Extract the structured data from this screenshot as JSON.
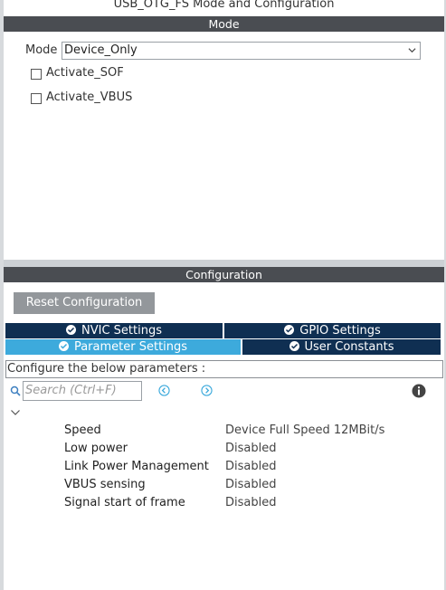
{
  "window_title": "USB_OTG_FS Mode and Configuration",
  "mode_section": {
    "header": "Mode",
    "mode_label": "Mode",
    "mode_value": "Device_Only",
    "checkboxes": [
      {
        "label": "Activate_SOF",
        "checked": false
      },
      {
        "label": "Activate_VBUS",
        "checked": false
      }
    ]
  },
  "config_section": {
    "header": "Configuration",
    "reset_button": "Reset Configuration",
    "tabs": [
      {
        "label": "NVIC Settings",
        "active": false
      },
      {
        "label": "GPIO Settings",
        "active": false
      },
      {
        "label": "Parameter Settings",
        "active": true
      },
      {
        "label": "User Constants",
        "active": false
      }
    ],
    "params_caption": "Configure the below parameters :",
    "search_placeholder": "Search (Ctrl+F)",
    "parameters": [
      {
        "name": "Speed",
        "value": "Device Full Speed 12MBit/s"
      },
      {
        "name": "Low power",
        "value": "Disabled"
      },
      {
        "name": "Link Power Management",
        "value": "Disabled"
      },
      {
        "name": "VBUS sensing",
        "value": "Disabled"
      },
      {
        "name": "Signal start of frame",
        "value": "Disabled"
      }
    ]
  },
  "colors": {
    "header_bg": "#4a4d52",
    "tab_dark": "#0f2f52",
    "tab_active": "#3daadc",
    "button_bg": "#93979b",
    "nav_icon": "#3daadc"
  },
  "icons": [
    "chevron-down-icon",
    "check-circle-icon",
    "search-icon",
    "back-arrow-icon",
    "forward-arrow-icon",
    "info-icon",
    "collapse-chevron-icon"
  ]
}
